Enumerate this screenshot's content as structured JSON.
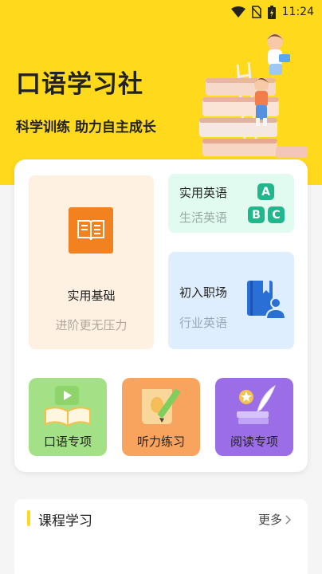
{
  "status_bar": {
    "time": "11:24",
    "icons": [
      "wifi-icon",
      "no-sim-icon",
      "battery-charging-icon"
    ]
  },
  "hero": {
    "title": "口语学习社",
    "slogan": "科学训练  助力自主成长",
    "illustration": "kids-on-books-illustration"
  },
  "tiles": {
    "basic": {
      "title": "实用基础",
      "subtitle": "进阶更无压力",
      "icon": "book-icon",
      "color": "#f2821f"
    },
    "english": {
      "title": "实用英语",
      "subtitle": "生活英语",
      "letters": [
        "A",
        "B",
        "C"
      ],
      "color": "#1fb78b"
    },
    "workplace": {
      "title": "初入职场",
      "subtitle": "行业英语",
      "icon": "book-person-icon",
      "color": "#2a6fd6"
    }
  },
  "mini_tiles": [
    {
      "label": "口语专项",
      "icon": "open-book-video-icon"
    },
    {
      "label": "听力练习",
      "icon": "scroll-pencil-icon"
    },
    {
      "label": "阅读专项",
      "icon": "book-quill-icon"
    }
  ],
  "course": {
    "title": "课程学习",
    "more": "更多"
  }
}
